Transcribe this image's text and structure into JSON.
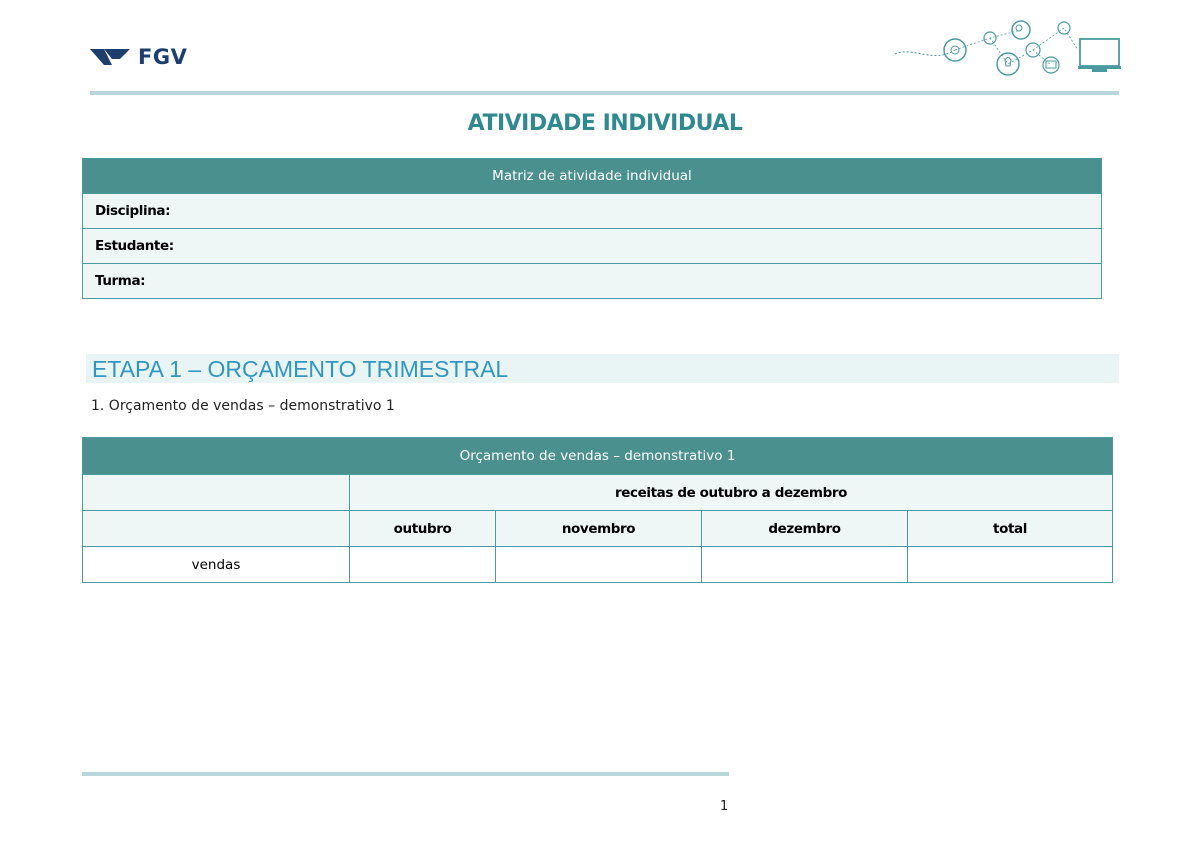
{
  "header": {
    "logo_text": "FGV",
    "brand_color": "#1d3f6e",
    "decoration": "tech-icons-network"
  },
  "title": "ATIVIDADE INDIVIDUAL",
  "matrix": {
    "heading": "Matriz de atividade individual",
    "fields": [
      "Disciplina:",
      "Estudante:",
      "Turma:"
    ]
  },
  "section": {
    "heading": "ETAPA 1 – ORÇAMENTO TRIMESTRAL",
    "subtitle": "1. Orçamento de vendas – demonstrativo 1"
  },
  "budget_table": {
    "heading": "Orçamento de vendas – demonstrativo 1",
    "group_label": "receitas de outubro a dezembro",
    "columns": [
      "outubro",
      "novembro",
      "dezembro",
      "total"
    ],
    "row_label": "vendas"
  },
  "footer": {
    "page_number": "1"
  },
  "colors": {
    "accent": "#2f8a90",
    "table_header": "#4a908f",
    "section_heading": "#2f97c2"
  }
}
